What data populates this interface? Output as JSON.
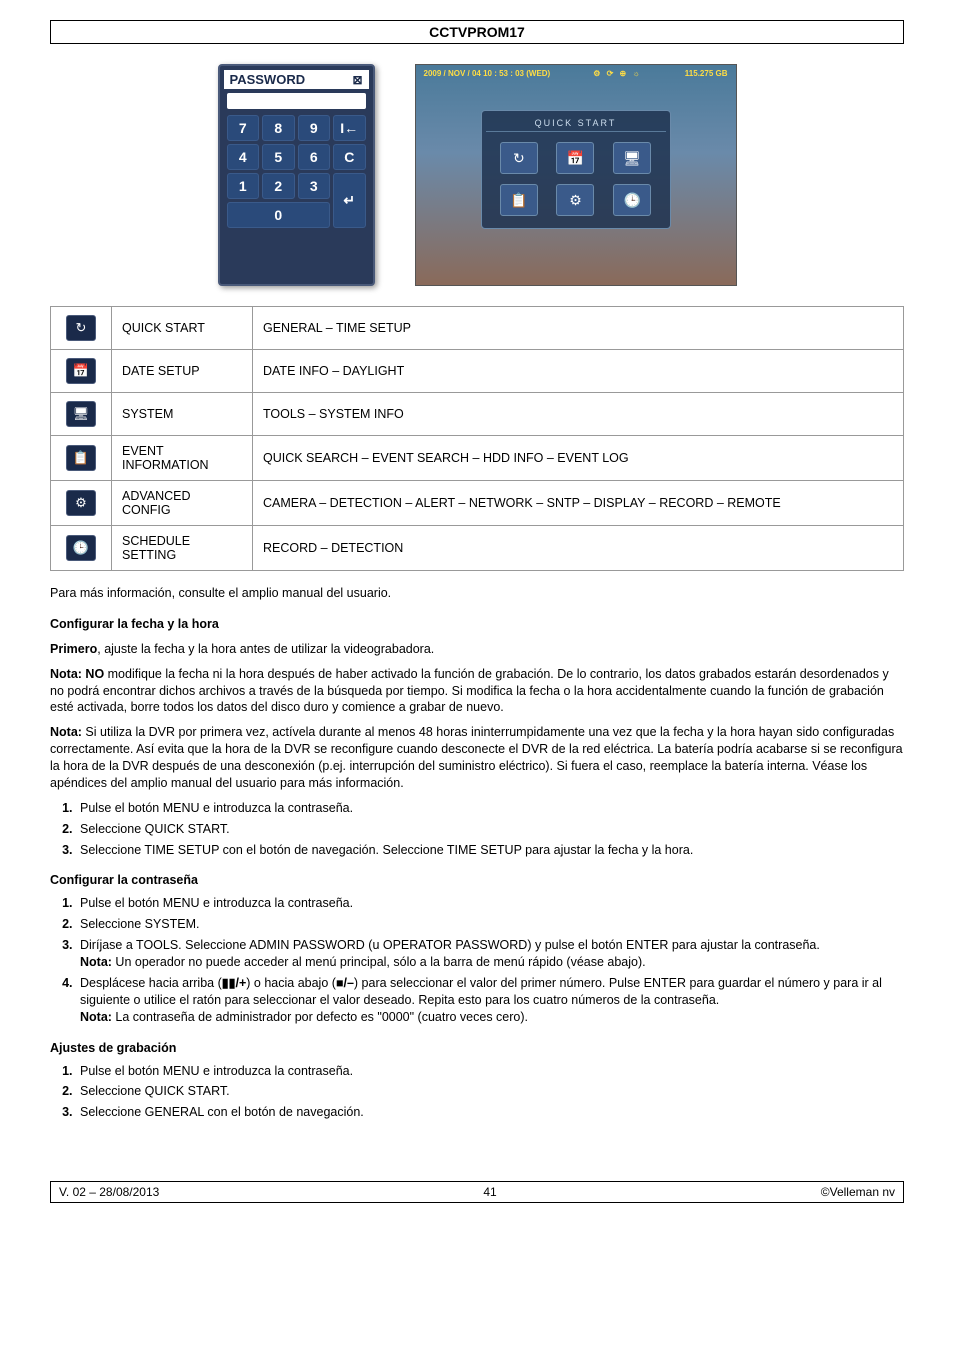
{
  "header": {
    "title": "CCTVPROM17"
  },
  "password": {
    "title": "PASSWORD",
    "keys": {
      "k7": "7",
      "k8": "8",
      "k9": "9",
      "back": "I←",
      "k4": "4",
      "k5": "5",
      "k6": "6",
      "c": "C",
      "k1": "1",
      "k2": "2",
      "k3": "3",
      "enter": "↵",
      "k0": "0"
    }
  },
  "dvr": {
    "timestamp": "2009 / NOV / 04  10 : 53 : 03  (WED)",
    "hdd": "115.275 GB",
    "panel_title": "QUICK START"
  },
  "table": {
    "rows": [
      {
        "icon": "↻",
        "label": "QUICK START",
        "desc": "GENERAL – TIME SETUP"
      },
      {
        "icon": "📅",
        "label": "DATE SETUP",
        "desc": "DATE INFO – DAYLIGHT"
      },
      {
        "icon": "🖥",
        "label": "SYSTEM",
        "desc": "TOOLS – SYSTEM INFO"
      },
      {
        "icon": "📋",
        "label": "EVENT INFORMATION",
        "desc": "QUICK SEARCH – EVENT SEARCH – HDD INFO – EVENT LOG"
      },
      {
        "icon": "⚙",
        "label": "ADVANCED CONFIG",
        "desc": "CAMERA – DETECTION – ALERT – NETWORK – SNTP – DISPLAY – RECORD – REMOTE"
      },
      {
        "icon": "🕒",
        "label": "SCHEDULE SETTING",
        "desc": "RECORD – DETECTION"
      }
    ]
  },
  "body": {
    "para_info": "Para más información, consulte el amplio manual del usuario.",
    "sec1_title": "Configurar la fecha y la hora",
    "sec1_p1a": "Primero",
    "sec1_p1b": ", ajuste la fecha y la hora antes de utilizar la videograbadora.",
    "sec1_p2a": "Nota: NO",
    "sec1_p2b": " modifique la fecha ni la hora después de haber activado la función de grabación. De lo contrario, los datos grabados estarán desordenados y no podrá encontrar dichos archivos a través de la búsqueda por tiempo. Si modifica la fecha o la hora accidentalmente cuando la función de grabación esté activada, borre todos los datos del disco duro y comience a grabar de nuevo.",
    "sec1_p3a": "Nota:",
    "sec1_p3b": " Si utiliza la DVR por primera vez, actívela durante al menos 48 horas ininterrumpidamente una vez que la fecha y la hora hayan sido configuradas correctamente. Así evita que la hora de la DVR se reconfigure cuando desconecte el DVR de la red eléctrica. La batería podría acabarse si se reconfigura la hora de la DVR después de una desconexión (p.ej. interrupción del suministro eléctrico). Si fuera el caso, reemplace la batería interna. Véase los apéndices del amplio manual del usuario para más información.",
    "sec1_li1": "Pulse el botón MENU e introduzca la contraseña.",
    "sec1_li2": "Seleccione QUICK START.",
    "sec1_li3": "Seleccione TIME SETUP con el botón de navegación. Seleccione TIME SETUP para ajustar la fecha y la hora.",
    "sec2_title": "Configurar la contraseña",
    "sec2_li1": "Pulse el botón MENU e introduzca la contraseña.",
    "sec2_li2": "Seleccione SYSTEM.",
    "sec2_li3_a": "Diríjase a TOOLS. Seleccione ADMIN PASSWORD (u OPERATOR PASSWORD) y pulse el botón ENTER para ajustar la contraseña.",
    "sec2_li3_note_a": "Nota:",
    "sec2_li3_note_b": " Un operador no puede acceder al menú principal, sólo a la barra de menú rápido (véase abajo).",
    "sec2_li4_a": "Desplácese hacia arriba (",
    "sec2_li4_sym1": "▮▮/+",
    "sec2_li4_b": ") o hacia abajo (",
    "sec2_li4_sym2": "■/–",
    "sec2_li4_c": ") para seleccionar el valor del primer número. Pulse ENTER para guardar el número y para ir al siguiente o utilice el ratón para seleccionar el valor deseado. Repita esto para los cuatro números de la contraseña.",
    "sec2_li4_note_a": "Nota:",
    "sec2_li4_note_b": " La contraseña de administrador por defecto es \"0000\" (cuatro veces cero).",
    "sec3_title": "Ajustes de grabación",
    "sec3_li1": "Pulse el botón MENU e introduzca la contraseña.",
    "sec3_li2": "Seleccione QUICK START.",
    "sec3_li3": "Seleccione GENERAL con el botón de navegación."
  },
  "footer": {
    "left": "V. 02 – 28/08/2013",
    "center": "41",
    "right": "©Velleman nv"
  }
}
